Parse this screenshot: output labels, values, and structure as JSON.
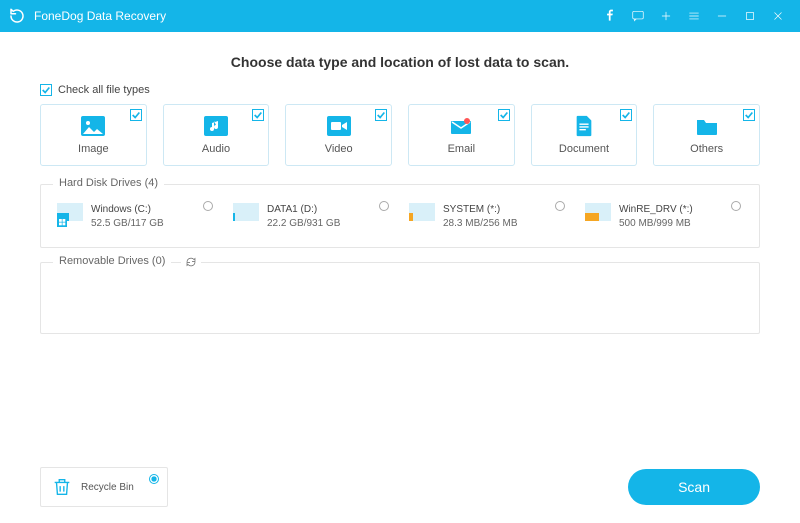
{
  "titlebar": {
    "title": "FoneDog Data Recovery"
  },
  "heading": "Choose data type and location of lost data to scan.",
  "check_all_label": "Check all file types",
  "types": [
    {
      "label": "Image"
    },
    {
      "label": "Audio"
    },
    {
      "label": "Video"
    },
    {
      "label": "Email"
    },
    {
      "label": "Document"
    },
    {
      "label": "Others"
    }
  ],
  "hdd": {
    "title": "Hard Disk Drives (4)",
    "drives": [
      {
        "name": "Windows (C:)",
        "size": "52.5 GB/117 GB"
      },
      {
        "name": "DATA1 (D:)",
        "size": "22.2 GB/931 GB"
      },
      {
        "name": "SYSTEM (*:)",
        "size": "28.3 MB/256 MB"
      },
      {
        "name": "WinRE_DRV (*:)",
        "size": "500 MB/999 MB"
      }
    ]
  },
  "removable": {
    "title": "Removable Drives (0)"
  },
  "recycle": {
    "label": "Recycle Bin"
  },
  "scan_label": "Scan"
}
